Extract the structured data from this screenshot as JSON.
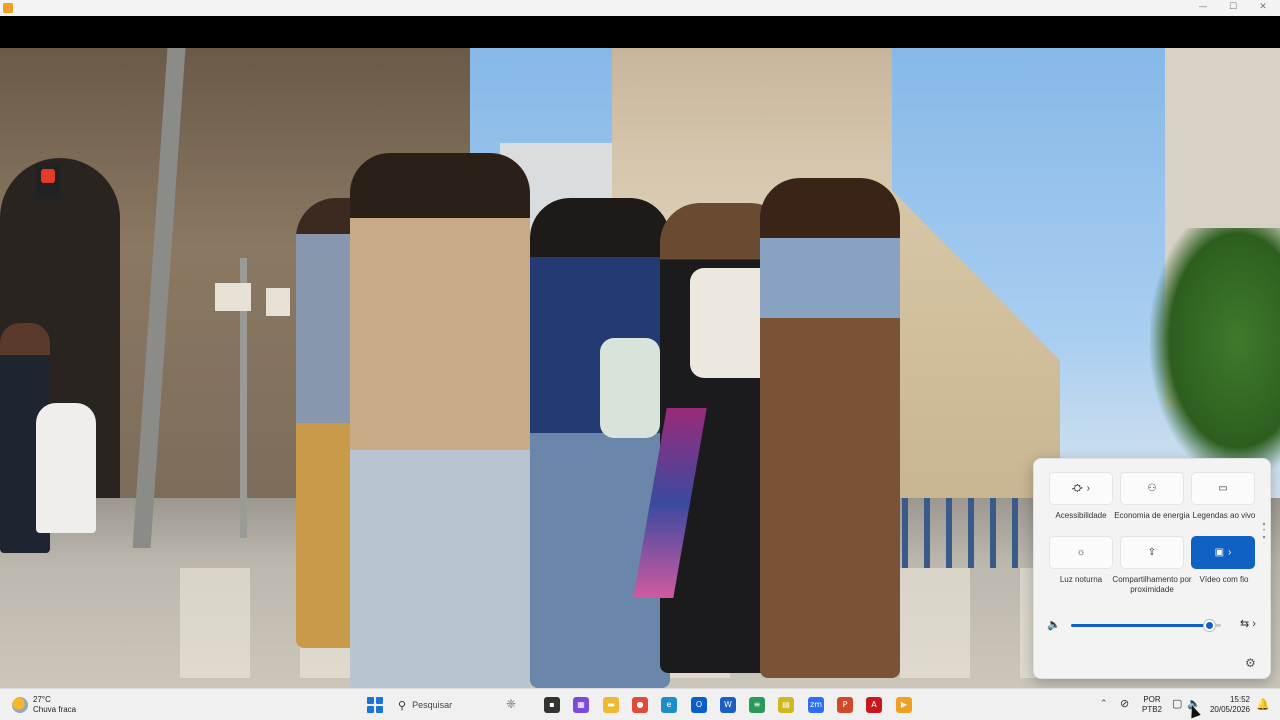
{
  "window": {
    "title": "",
    "controls": {
      "minimize": "—",
      "maximize": "☐",
      "close": "✕"
    }
  },
  "video": {
    "description_label": ""
  },
  "quick_settings": {
    "tiles": [
      {
        "label": "Acessibilidade",
        "icon": "accessibility-icon",
        "glyph": "⛮",
        "has_arrow": true,
        "active": false
      },
      {
        "label": "Economia de energia",
        "icon": "battery-saver-icon",
        "glyph": "⚇",
        "has_arrow": false,
        "active": false
      },
      {
        "label": "Legendas ao vivo",
        "icon": "live-captions-icon",
        "glyph": "▭",
        "has_arrow": false,
        "active": false
      },
      {
        "label": "Luz noturna",
        "icon": "night-light-icon",
        "glyph": "☼",
        "has_arrow": false,
        "active": false
      },
      {
        "label": "Compartilhamento por proximidade",
        "icon": "nearby-share-icon",
        "glyph": "⇪",
        "has_arrow": false,
        "active": false
      },
      {
        "label": "Vídeo com fio",
        "icon": "cast-icon",
        "glyph": "▣",
        "has_arrow": true,
        "active": true
      }
    ],
    "volume": {
      "level": 0.92,
      "icon": "speaker-icon",
      "output_icon": "audio-output-icon",
      "glyph": "🔈",
      "output_glyph": "⇆ ›"
    },
    "settings_icon": "gear-icon",
    "settings_glyph": "⚙",
    "accent_color": "#0f62c4"
  },
  "taskbar": {
    "weather": {
      "temp": "27°C",
      "condition": "Chuva fraca"
    },
    "search_placeholder": "Pesquisar",
    "search_glyph": "⚲",
    "apps": [
      {
        "name": "task-view-icon",
        "color": "#333333",
        "glyph": "▪"
      },
      {
        "name": "store-icon",
        "color": "#7a4ad8",
        "glyph": "▦"
      },
      {
        "name": "file-explorer-icon",
        "color": "#f0b830",
        "glyph": "▬"
      },
      {
        "name": "chrome-icon",
        "color": "#e04a3a",
        "glyph": "●"
      },
      {
        "name": "edge-icon",
        "color": "#1b8ec9",
        "glyph": "e"
      },
      {
        "name": "outlook-icon",
        "color": "#0a5ec8",
        "glyph": "O"
      },
      {
        "name": "word-icon",
        "color": "#1a5fc0",
        "glyph": "W"
      },
      {
        "name": "notepad-icon",
        "color": "#2a9a5a",
        "glyph": "≡"
      },
      {
        "name": "note-icon",
        "color": "#d0b820",
        "glyph": "▤"
      },
      {
        "name": "zoom-icon",
        "color": "#2d6ef2",
        "glyph": "zm"
      },
      {
        "name": "powerpoint-icon",
        "color": "#d04a2a",
        "glyph": "P"
      },
      {
        "name": "acrobat-icon",
        "color": "#c8181e",
        "glyph": "A"
      },
      {
        "name": "media-player-icon",
        "color": "#f0a020",
        "glyph": "▶"
      }
    ],
    "tray": {
      "chevron": "⌃",
      "wifi_off_glyph": "⊘",
      "language_line1": "POR",
      "language_line2": "PTB2",
      "network_glyph": "▢",
      "volume_glyph": "🔈",
      "time": "15:52",
      "date": "20/05/2026",
      "notification_glyph": "🔔"
    }
  }
}
